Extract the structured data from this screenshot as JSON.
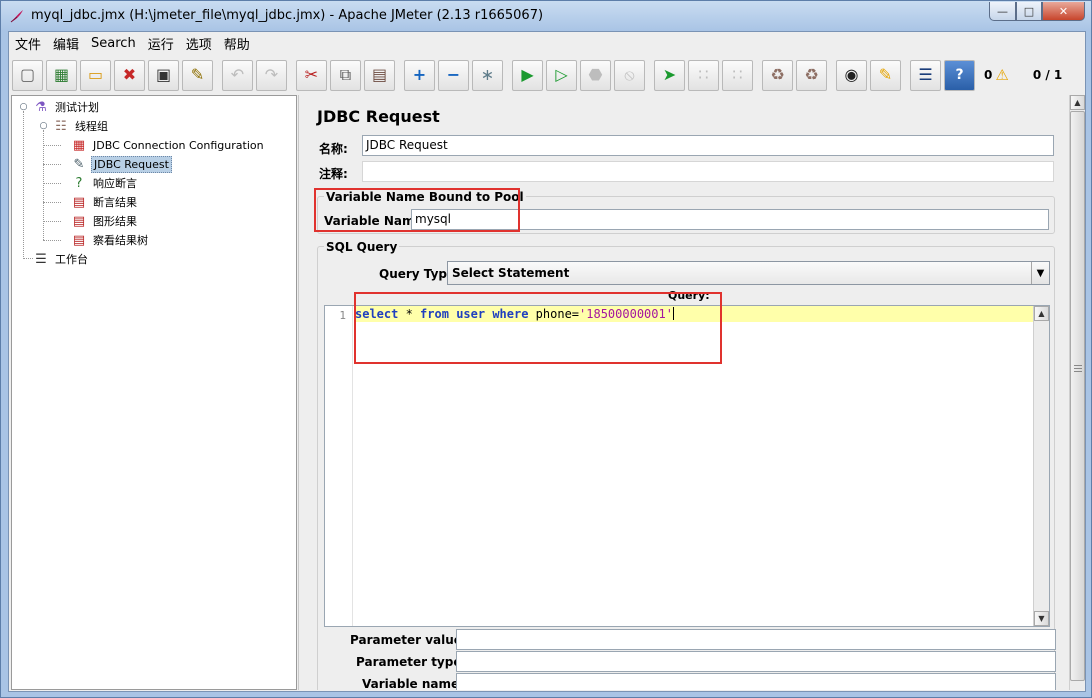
{
  "window": {
    "title": "myql_jdbc.jmx (H:\\jmeter_file\\myql_jdbc.jmx) - Apache JMeter (2.13 r1665067)",
    "min_label": "—",
    "max_label": "□",
    "close_label": "✕"
  },
  "menu": [
    "文件",
    "编辑",
    "Search",
    "运行",
    "选项",
    "帮助"
  ],
  "toolbar": {
    "icons": [
      "new-icon",
      "templates-icon",
      "open-icon",
      "close-icon",
      "save-icon",
      "save-screenshot-icon",
      "undo-icon",
      "redo-icon",
      "cut-icon",
      "copy-icon",
      "paste-icon",
      "expand-icon",
      "collapse-icon",
      "toggle-icon",
      "start-icon",
      "start-no-pause-icon",
      "stop-icon",
      "shutdown-icon",
      "remote-start-icon",
      "remote-stop-icon",
      "remote-exit-icon",
      "clear-icon",
      "clear-all-icon",
      "search-icon",
      "reset-search-icon",
      "function-helper-icon",
      "help-icon"
    ],
    "error_count": "0",
    "thread_count": "0 / 1"
  },
  "tree": {
    "test_plan": "测试计划",
    "thread_group": "线程组",
    "jdbc_config": "JDBC Connection Configuration",
    "jdbc_request": "JDBC Request",
    "response_assertion": "响应断言",
    "assertion_results": "断言结果",
    "graph_results": "图形结果",
    "view_results_tree": "察看结果树",
    "workbench": "工作台"
  },
  "panel": {
    "title": "JDBC Request",
    "name_label": "名称:",
    "name_value": "JDBC Request",
    "comment_label": "注释:",
    "comment_value": "",
    "pool_group_title": "Variable Name Bound to Pool",
    "variable_name_label": "Variable Name:",
    "variable_name_value": "mysql",
    "sql_group_title": "SQL Query",
    "query_type_label": "Query Type:",
    "query_type_value": "Select Statement",
    "query_label": "Query:",
    "query_line_number": "1",
    "query": {
      "kw_select": "select",
      "star": " * ",
      "kw_from": "from",
      "kw_user": "user",
      "kw_where": "where",
      "phone": " phone=",
      "value": "'18500000001'"
    },
    "parameter_values_label": "Parameter values:",
    "parameter_types_label": "Parameter types:",
    "variable_names_label": "Variable names:"
  },
  "colors": {
    "highlight_red": "#e0322e",
    "current_line": "#ffffaa",
    "keyword": "#1f3fbf",
    "string": "#a4169f"
  }
}
